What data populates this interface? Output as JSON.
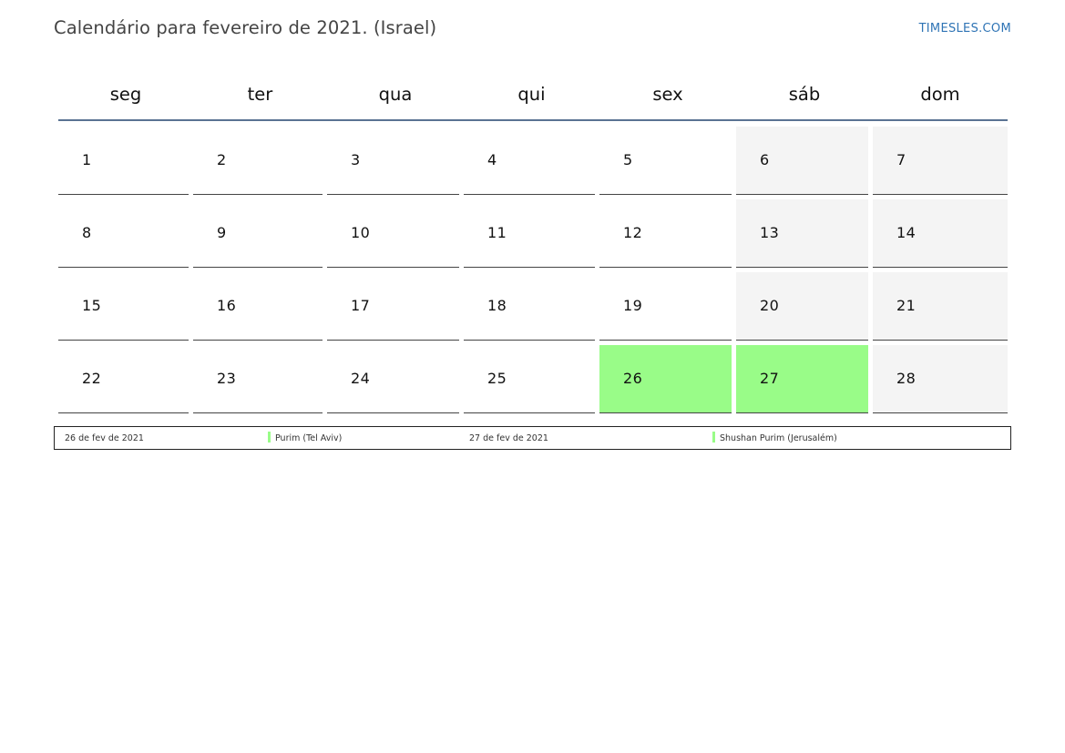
{
  "header": {
    "title": "Calendário para fevereiro de 2021. (Israel)",
    "site": "TIMESLES.COM"
  },
  "colors": {
    "header_rule": "#5a7393",
    "weekend_bg": "#f4f4f4",
    "holiday_bg": "#99fc88",
    "site_link": "#2f74b5"
  },
  "calendar": {
    "weekdays": [
      "seg",
      "ter",
      "qua",
      "qui",
      "sex",
      "sáb",
      "dom"
    ],
    "weeks": [
      [
        {
          "day": "1",
          "type": "normal"
        },
        {
          "day": "2",
          "type": "normal"
        },
        {
          "day": "3",
          "type": "normal"
        },
        {
          "day": "4",
          "type": "normal"
        },
        {
          "day": "5",
          "type": "normal"
        },
        {
          "day": "6",
          "type": "weekend"
        },
        {
          "day": "7",
          "type": "weekend"
        }
      ],
      [
        {
          "day": "8",
          "type": "normal"
        },
        {
          "day": "9",
          "type": "normal"
        },
        {
          "day": "10",
          "type": "normal"
        },
        {
          "day": "11",
          "type": "normal"
        },
        {
          "day": "12",
          "type": "normal"
        },
        {
          "day": "13",
          "type": "weekend"
        },
        {
          "day": "14",
          "type": "weekend"
        }
      ],
      [
        {
          "day": "15",
          "type": "normal"
        },
        {
          "day": "16",
          "type": "normal"
        },
        {
          "day": "17",
          "type": "normal"
        },
        {
          "day": "18",
          "type": "normal"
        },
        {
          "day": "19",
          "type": "normal"
        },
        {
          "day": "20",
          "type": "weekend"
        },
        {
          "day": "21",
          "type": "weekend"
        }
      ],
      [
        {
          "day": "22",
          "type": "normal"
        },
        {
          "day": "23",
          "type": "normal"
        },
        {
          "day": "24",
          "type": "normal"
        },
        {
          "day": "25",
          "type": "normal"
        },
        {
          "day": "26",
          "type": "holiday"
        },
        {
          "day": "27",
          "type": "holiday"
        },
        {
          "day": "28",
          "type": "weekend"
        }
      ]
    ]
  },
  "legend": [
    {
      "date": "26 de fev de 2021",
      "name": "Purim (Tel Aviv)"
    },
    {
      "date": "27 de fev de 2021",
      "name": "Shushan Purim (Jerusalém)"
    }
  ]
}
